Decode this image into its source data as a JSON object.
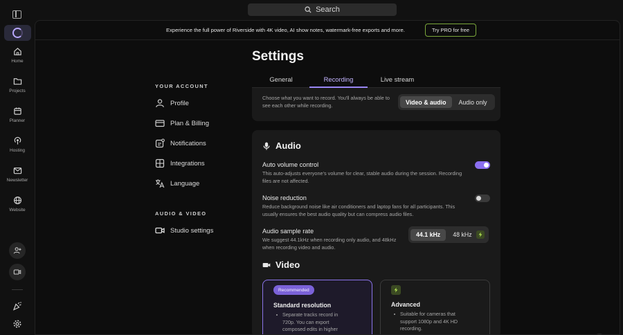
{
  "search": {
    "label": "Search"
  },
  "rail": {
    "items": [
      {
        "label": "Home",
        "icon": "home-icon"
      },
      {
        "label": "Projects",
        "icon": "folder-icon"
      },
      {
        "label": "Planner",
        "icon": "calendar-icon"
      },
      {
        "label": "Hosting",
        "icon": "podcast-icon"
      },
      {
        "label": "Newsletter",
        "icon": "mail-icon"
      },
      {
        "label": "Website",
        "icon": "globe-icon"
      }
    ]
  },
  "banner": {
    "text": "Experience the full power of Riverside with 4K video, AI show notes, watermark-free exports and more.",
    "cta": "Try PRO for free"
  },
  "page": {
    "title": "Settings"
  },
  "nav": {
    "account_heading": "YOUR ACCOUNT",
    "account_items": [
      {
        "label": "Profile",
        "icon": "user-icon"
      },
      {
        "label": "Plan & Billing",
        "icon": "credit-card-icon"
      },
      {
        "label": "Notifications",
        "icon": "bell-icon"
      },
      {
        "label": "Integrations",
        "icon": "puzzle-icon"
      },
      {
        "label": "Language",
        "icon": "translate-icon"
      }
    ],
    "av_heading": "AUDIO & VIDEO",
    "av_items": [
      {
        "label": "Studio settings",
        "icon": "camera-icon"
      }
    ]
  },
  "tabs": [
    {
      "label": "General"
    },
    {
      "label": "Recording"
    },
    {
      "label": "Live stream"
    }
  ],
  "record_mode": {
    "description": "Choose what you want to record. You'll always be able to see each other while recording.",
    "options": [
      "Video & audio",
      "Audio only"
    ],
    "selected": "Video & audio"
  },
  "audio": {
    "heading": "Audio",
    "auto_volume": {
      "title": "Auto volume control",
      "description": "This auto-adjusts everyone's volume for clear, stable audio during the session. Recording files are not affected.",
      "enabled": true
    },
    "noise_reduction": {
      "title": "Noise reduction",
      "description": "Reduce background noise like air conditioners and laptop fans for all participants. This usually ensures the best audio quality but can compress audio files.",
      "enabled": false
    },
    "sample_rate": {
      "title": "Audio sample rate",
      "description": "We suggest 44.1kHz when recording only audio, and 48kHz when recording video and audio.",
      "options": [
        "44.1 kHz",
        "48 kHz"
      ],
      "selected": "44.1 kHz"
    }
  },
  "video": {
    "heading": "Video",
    "standard": {
      "badge": "Recommended",
      "title": "Standard resolution",
      "bullet": "Separate tracks record in 720p. You can export composed edits in higher"
    },
    "advanced": {
      "title": "Advanced",
      "bullet": "Suitable for cameras that support 1080p and 4K HD recording."
    }
  },
  "colors": {
    "accent": "#9a86f5",
    "toggle_on": "#8b6ff0",
    "pro_border": "#7aa63a",
    "bolt": "#b5e655"
  }
}
